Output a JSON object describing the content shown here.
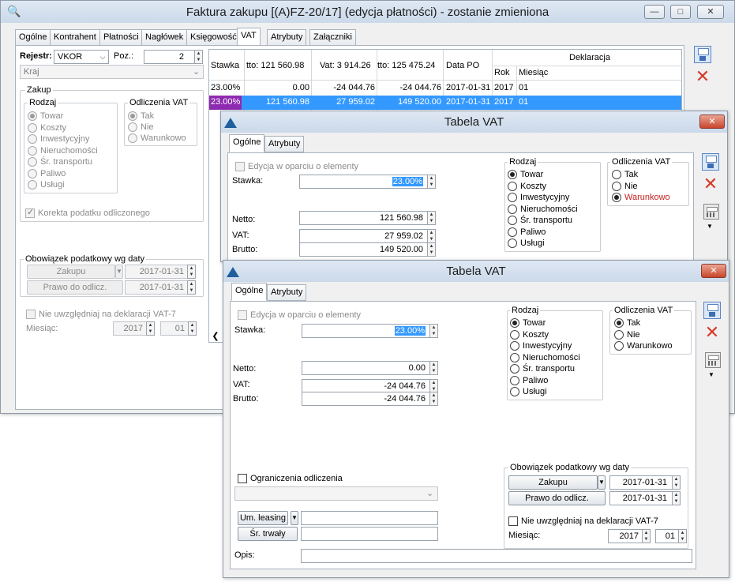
{
  "main": {
    "title": "Faktura zakupu [(A)FZ-20/17] (edycja płatności) - zostanie zmieniona",
    "tabs": [
      "Ogólne",
      "Kontrahent",
      "Płatności",
      "Nagłówek",
      "Księgowość",
      "VAT",
      "Atrybuty",
      "Załączniki"
    ],
    "rejestr_label": "Rejestr:",
    "rejestr_value": "VKOR",
    "poz_label": "Poz.:",
    "poz_value": "2",
    "kraj_placeholder": "Kraj",
    "zakup_label": "Zakup",
    "rodzaj_label": "Rodzaj",
    "rodzaj_items": [
      "Towar",
      "Koszty",
      "Inwestycyjny",
      "Nieruchomości",
      "Śr. transportu",
      "Paliwo",
      "Usługi"
    ],
    "odliczenia_label": "Odliczenia VAT",
    "odliczenia_items": [
      "Tak",
      "Nie",
      "Warunkowo"
    ],
    "korekta_label": "Korekta podatku odliczonego",
    "obowiazek_label": "Obowiązek podatkowy wg daty",
    "zakupu_btn": "Zakupu",
    "zakupu_date": "2017-01-31",
    "prawo_btn": "Prawo do odlicz.",
    "prawo_date": "2017-01-31",
    "nie_uwzgl_label": "Nie uwzględniaj na deklaracji VAT-7",
    "miesiac_label": "Miesiąc:",
    "miesiac_year": "2017",
    "miesiac_month": "01",
    "table": {
      "headers": [
        "Stawka",
        "tto: 121 560.98",
        "Vat: 3 914.26",
        "tto: 125 475.24",
        "Data PO",
        "Deklaracja",
        "Rok",
        "Miesiąc"
      ],
      "rows": [
        [
          "23.00%",
          "0.00",
          "-24 044.76",
          "-24 044.76",
          "2017-01-31",
          "2017",
          "01"
        ],
        [
          "23.00%",
          "121 560.98",
          "27 959.02",
          "149 520.00",
          "2017-01-31",
          "2017",
          "01"
        ]
      ]
    }
  },
  "vat1": {
    "title": "Tabela VAT",
    "tabs": [
      "Ogólne",
      "Atrybuty"
    ],
    "edycja_label": "Edycja w oparciu o elementy",
    "stawka_label": "Stawka:",
    "stawka_value": "23.00%",
    "netto_label": "Netto:",
    "netto_value": "121 560.98",
    "vat_label": "VAT:",
    "vat_value": "27 959.02",
    "brutto_label": "Brutto:",
    "brutto_value": "149 520.00",
    "rodzaj_label": "Rodzaj",
    "rodzaj_items": [
      "Towar",
      "Koszty",
      "Inwestycyjny",
      "Nieruchomości",
      "Śr. transportu",
      "Paliwo",
      "Usługi"
    ],
    "odliczenia_label": "Odliczenia VAT",
    "odliczenia_items": [
      "Tak",
      "Nie",
      "Warunkowo"
    ]
  },
  "vat2": {
    "title": "Tabela VAT",
    "tabs": [
      "Ogólne",
      "Atrybuty"
    ],
    "edycja_label": "Edycja w oparciu o elementy",
    "stawka_label": "Stawka:",
    "stawka_value": "23.00%",
    "netto_label": "Netto:",
    "netto_value": "0.00",
    "vat_label": "VAT:",
    "vat_value": "-24 044.76",
    "brutto_label": "Brutto:",
    "brutto_value": "-24 044.76",
    "rodzaj_label": "Rodzaj",
    "rodzaj_items": [
      "Towar",
      "Koszty",
      "Inwestycyjny",
      "Nieruchomości",
      "Śr. transportu",
      "Paliwo",
      "Usługi"
    ],
    "odliczenia_label": "Odliczenia VAT",
    "odliczenia_items": [
      "Tak",
      "Nie",
      "Warunkowo"
    ],
    "obowiazek_label": "Obowiązek podatkowy wg daty",
    "zakupu_btn": "Zakupu",
    "zakupu_date": "2017-01-31",
    "prawo_btn": "Prawo do odlicz.",
    "prawo_date": "2017-01-31",
    "nie_uwzgl_label": "Nie uwzględniaj na deklaracji VAT-7",
    "miesiac_label": "Miesiąc:",
    "miesiac_year": "2017",
    "miesiac_month": "01",
    "ograniczenia_label": "Ograniczenia odliczenia",
    "leasing_btn": "Um. leasing",
    "trwaly_btn": "Śr. trwały",
    "opis_label": "Opis:"
  },
  "colors": {
    "selection": "#3399ff",
    "close_icon": "#d43b28",
    "warunkowo_red": "#c81e1e"
  },
  "icons": [
    "search-icon",
    "save-icon",
    "cancel-icon",
    "calculator-icon",
    "app-logo-icon"
  ]
}
